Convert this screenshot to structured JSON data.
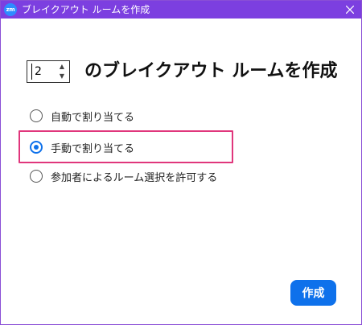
{
  "window": {
    "app_icon_text": "zm",
    "title": "ブレイクアウト ルームを作成"
  },
  "room_count": {
    "value": "2",
    "heading": "のブレイクアウト ルームを作成"
  },
  "options": [
    {
      "label": "自動で割り当てる",
      "checked": false
    },
    {
      "label": "手動で割り当てる",
      "checked": true
    },
    {
      "label": "参加者によるルーム選択を許可する",
      "checked": false
    }
  ],
  "footer": {
    "create_label": "作成"
  },
  "colors": {
    "titlebar": "#7c3fe0",
    "accent": "#0e71eb",
    "highlight": "#e0367c"
  }
}
